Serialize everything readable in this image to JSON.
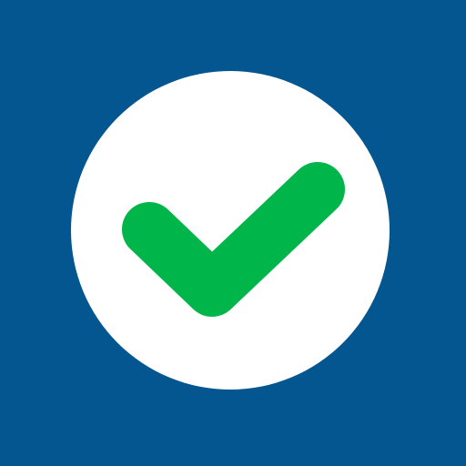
{
  "icon": {
    "name": "checkmark-icon",
    "background_color": "#03568F",
    "circle_color": "#FFFFFF",
    "check_color": "#00B54A"
  }
}
